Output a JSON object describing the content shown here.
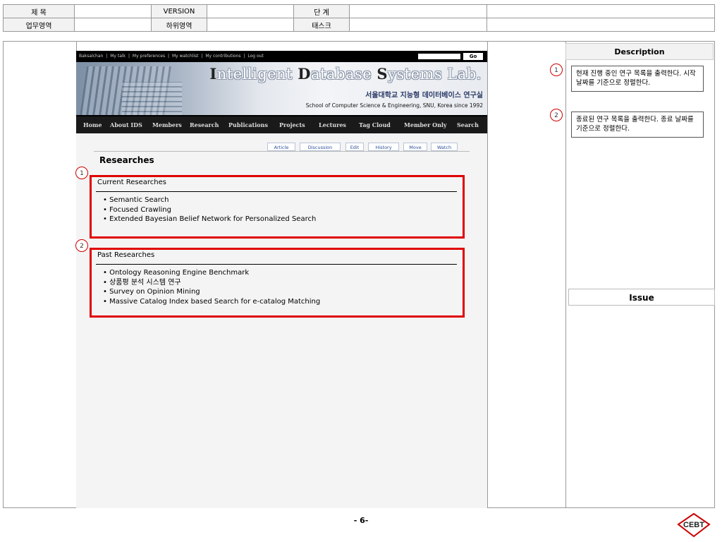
{
  "header_table": {
    "row1": [
      "제 목",
      "",
      "VERSION",
      "",
      "단 계",
      "",
      ""
    ],
    "row2": [
      "업무영역",
      "",
      "하위영역",
      "",
      "태스크",
      "",
      ""
    ]
  },
  "screenshot": {
    "topbar_links": [
      "Baksalchan",
      "|",
      "My talk",
      "|",
      "My preferences",
      "|",
      "My watchlist",
      "|",
      "My contributions",
      "|",
      "Log out"
    ],
    "go_label": "Go",
    "logo": {
      "i": "I",
      "ntelligent": "ntelligent",
      "d": "D",
      "atabase": "atabase",
      "s": "S",
      "ystems": "ystems Lab."
    },
    "korean_lab": "서울대학교 지능형 데이터베이스 연구실",
    "school_line": "School of Computer Science & Engineering, SNU, Korea since 1992",
    "nav": [
      "Home",
      "About IDS",
      "Members",
      "Research",
      "Publications",
      "Projects",
      "Lectures",
      "Tag Cloud",
      "Member Only",
      "Search"
    ],
    "tabs": [
      "Article",
      "Discussion",
      "Edit",
      "History",
      "Move",
      "Watch"
    ],
    "page_title": "Researches",
    "current": {
      "title": "Current Researches",
      "items": [
        "Semantic Search",
        "Focused Crawling",
        "Extended Bayesian Belief Network for Personalized Search"
      ]
    },
    "past": {
      "title": "Past Researches",
      "items": [
        "Ontology Reasoning Engine Benchmark",
        "상품평 분석 시스템 연구",
        "Survey on Opinion Mining",
        "Massive Catalog Index based Search for e-catalog Matching"
      ]
    }
  },
  "markers": [
    "1",
    "2"
  ],
  "description": {
    "header": "Description",
    "notes": [
      "현재 진행 중인 연구 목록을 출력한다. 시작 날짜를 기준으로 정렬한다.",
      "종료된 연구 목록을 출력한다. 종료 날짜를 기준으로 정렬한다."
    ]
  },
  "issue_header": "Issue",
  "page_number": "- 6-",
  "logo_text": "CEBT",
  "colors": {
    "highlight": "#e00000",
    "nav_bg": "#1a1a1a"
  }
}
